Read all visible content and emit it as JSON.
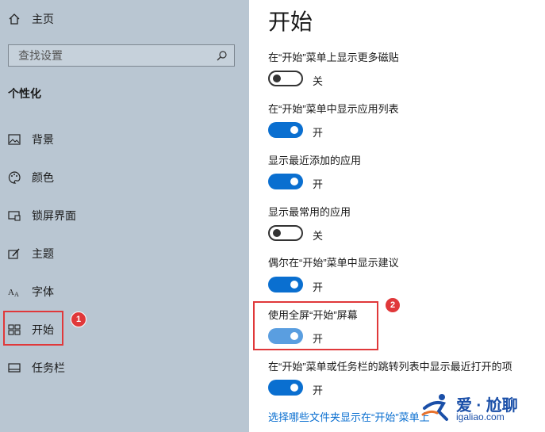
{
  "sidebar": {
    "home_label": "主页",
    "search_placeholder": "查找设置",
    "section_title": "个性化",
    "items": [
      {
        "label": "背景",
        "icon": "picture-icon"
      },
      {
        "label": "颜色",
        "icon": "palette-icon"
      },
      {
        "label": "锁屏界面",
        "icon": "lock-screen-icon"
      },
      {
        "label": "主题",
        "icon": "theme-icon"
      },
      {
        "label": "字体",
        "icon": "font-icon"
      },
      {
        "label": "开始",
        "icon": "start-icon"
      },
      {
        "label": "任务栏",
        "icon": "taskbar-icon"
      }
    ]
  },
  "main": {
    "title": "开始",
    "settings": [
      {
        "label": "在“开始”菜单上显示更多磁贴",
        "state": "关",
        "on": false
      },
      {
        "label": "在“开始”菜单中显示应用列表",
        "state": "开",
        "on": true
      },
      {
        "label": "显示最近添加的应用",
        "state": "开",
        "on": true
      },
      {
        "label": "显示最常用的应用",
        "state": "关",
        "on": false
      },
      {
        "label": "偶尔在“开始”菜单中显示建议",
        "state": "开",
        "on": true
      },
      {
        "label": "使用全屏“开始”屏幕",
        "state": "开",
        "on": true
      },
      {
        "label": "在“开始”菜单或任务栏的跳转列表中显示最近打开的项",
        "state": "开",
        "on": true
      }
    ],
    "link": "选择哪些文件夹显示在“开始”菜单上"
  },
  "annotations": {
    "badge1": "1",
    "badge2": "2"
  },
  "watermark": {
    "line1": "爱 · 尬聊",
    "line2": "igaliao.com"
  },
  "colors": {
    "accent": "#0a6fd0",
    "sidebar_bg": "#b9c6d2",
    "highlight": "#e0383a"
  }
}
